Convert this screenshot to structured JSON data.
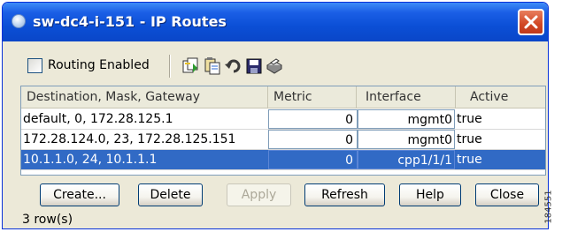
{
  "window": {
    "title": "sw-dc4-i-151 - IP Routes"
  },
  "toolbar": {
    "routing_enabled_label": "Routing Enabled",
    "routing_enabled_checked": false,
    "icons": [
      "copy-to-new-icon",
      "paste-icon",
      "undo-icon",
      "save-icon",
      "print-icon"
    ]
  },
  "table": {
    "columns": [
      "Destination, Mask, Gateway",
      "Metric",
      "Interface",
      "Active"
    ],
    "rows": [
      {
        "destination": "default, 0, 172.28.125.1",
        "metric": "0",
        "interface": "mgmt0",
        "active": "true"
      },
      {
        "destination": "172.28.124.0, 23, 172.28.125.151",
        "metric": "0",
        "interface": "mgmt0",
        "active": "true"
      },
      {
        "destination": "10.1.1.0, 24, 10.1.1.1",
        "metric": "0",
        "interface": "cpp1/1/1",
        "active": "true"
      }
    ],
    "selected_row": 2
  },
  "buttons": {
    "create": "Create...",
    "delete": "Delete",
    "apply": "Apply",
    "refresh": "Refresh",
    "help": "Help",
    "close": "Close"
  },
  "status": "3 row(s)",
  "figure_id": "184551",
  "colors": {
    "titlebar": "#0b4fd6",
    "selection": "#316ac5",
    "window_bg": "#ece9d8",
    "close_button": "#d14624"
  }
}
